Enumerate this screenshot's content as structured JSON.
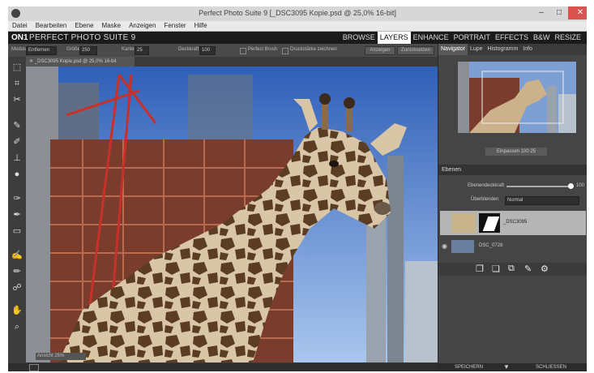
{
  "window": {
    "title": "Perfect Photo Suite 9 [_DSC3095 Kopie.psd @ 25,0% 16-bit]",
    "controls": {
      "minimize": "–",
      "maximize": "□",
      "close": "✕"
    }
  },
  "menu": [
    "Datei",
    "Bearbeiten",
    "Ebene",
    "Maske",
    "Anzeigen",
    "Fenster",
    "Hilfe"
  ],
  "brand": {
    "logo": "ON1",
    "suite": "PERFECT PHOTO SUITE 9"
  },
  "modules": [
    {
      "label": "BROWSE",
      "active": false
    },
    {
      "label": "LAYERS",
      "active": true
    },
    {
      "label": "ENHANCE",
      "active": false
    },
    {
      "label": "PORTRAIT",
      "active": false
    },
    {
      "label": "EFFECTS",
      "active": false
    },
    {
      "label": "B&W",
      "active": false
    },
    {
      "label": "RESIZE",
      "active": false
    }
  ],
  "options": {
    "mode_label": "Modus",
    "mode_value": "Entfernen",
    "size_label": "Größe",
    "size_value": "250",
    "feather_label": "Kante",
    "feather_value": "25",
    "opacity_label": "Deckkraft",
    "opacity_value": "100",
    "perfect_brush": "Perfect Brush",
    "pressure": "Druckstärke zeichnen",
    "btn_show": "Anzeigen",
    "btn_reset": "Zurücksetzen"
  },
  "document_tab": {
    "close": "✕",
    "name": "_DSC3095 Kopie.psd @ 25,0% 16-bit"
  },
  "canvas": {
    "zoom": "Ansicht 25%"
  },
  "panel": {
    "tabs": [
      {
        "label": "Navigator",
        "active": true
      },
      {
        "label": "Lupe",
        "active": false
      },
      {
        "label": "Histogramm",
        "active": false
      },
      {
        "label": "Info",
        "active": false
      }
    ],
    "nav_zoom": "Einpassen  100  25",
    "layers_title": "Ebenen",
    "opacity_label": "Ebenendeckkraft",
    "opacity_value": "100",
    "blend_label": "Überblenden",
    "blend_value": "Normal",
    "layers": [
      {
        "name": "_DSC3095",
        "selected": true
      },
      {
        "name": "DSC_0728",
        "selected": false
      }
    ],
    "save_label": "SPEICHERN",
    "close_label": "SCHLIESSEN"
  }
}
